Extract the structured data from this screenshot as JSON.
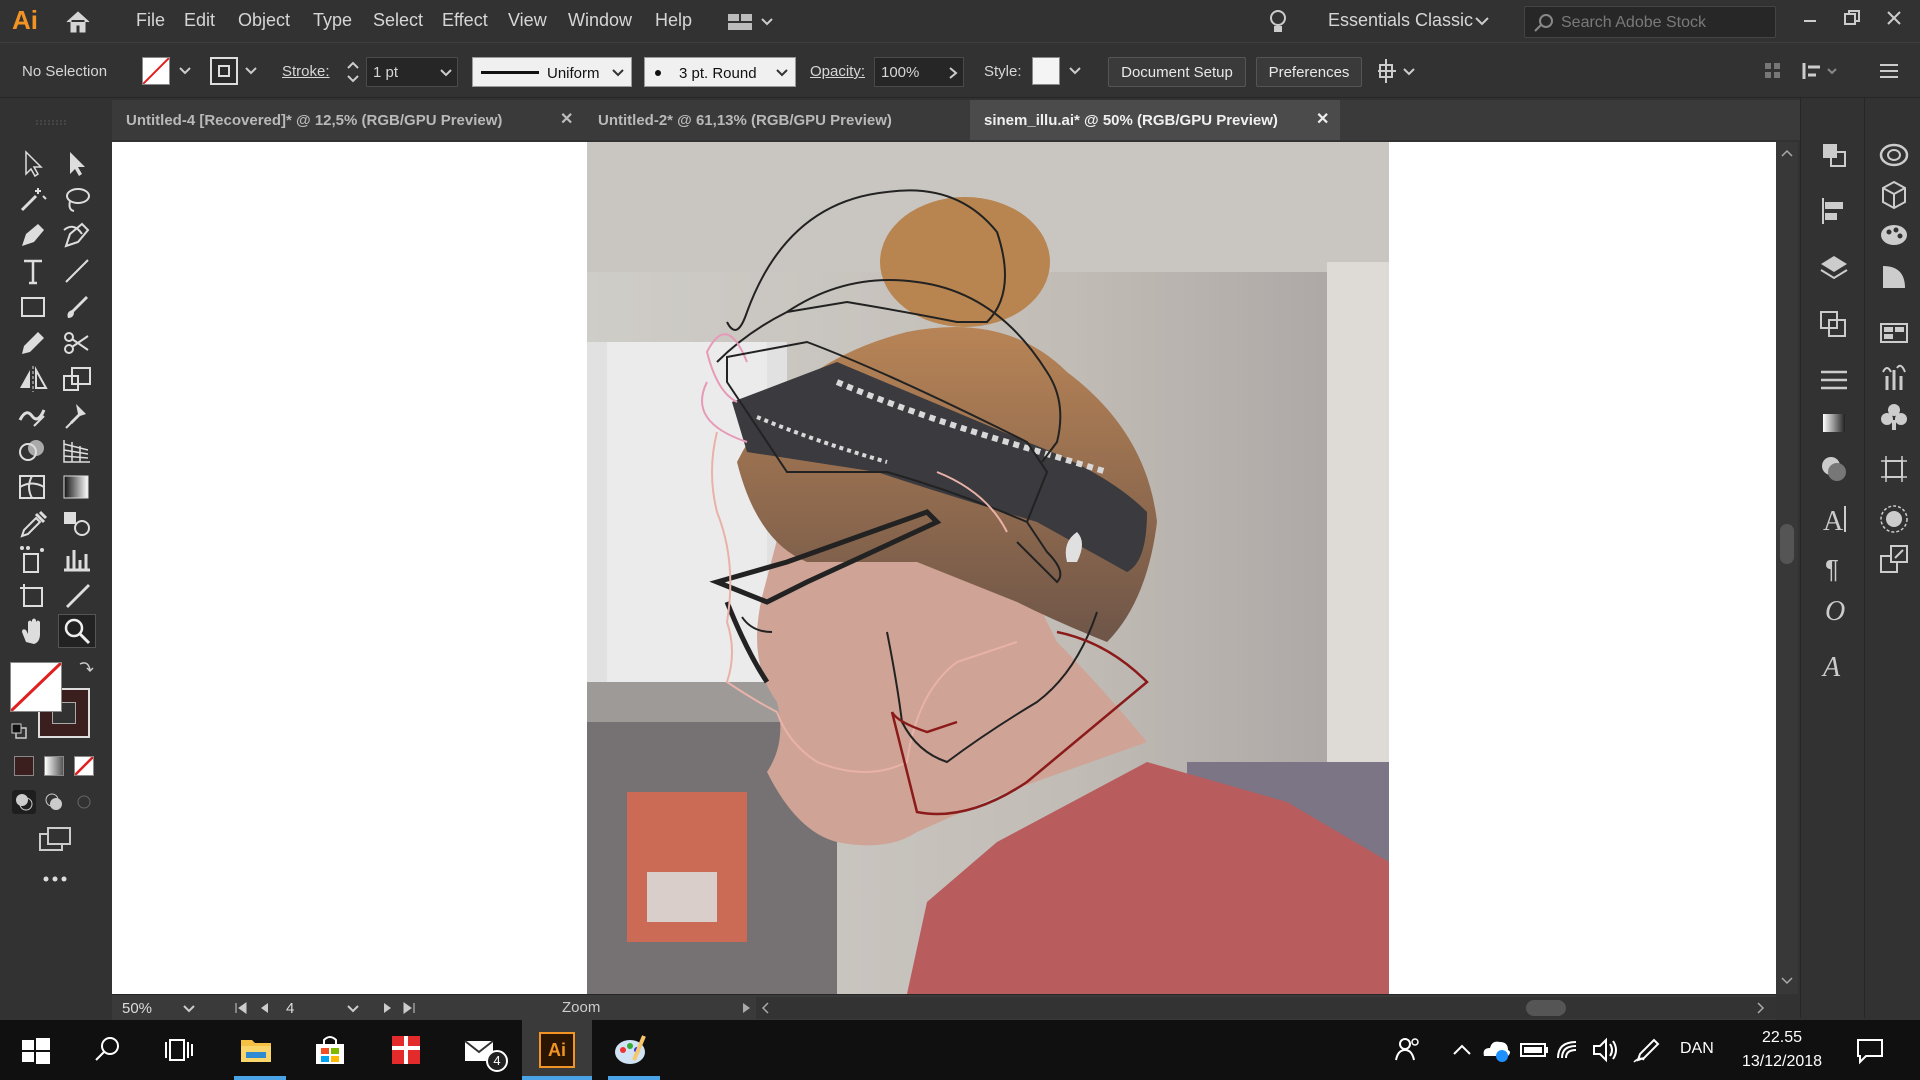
{
  "app": {
    "logo": "Ai",
    "workspace": "Essentials Classic",
    "search_placeholder": "Search Adobe Stock"
  },
  "menu": [
    "File",
    "Edit",
    "Object",
    "Type",
    "Select",
    "Effect",
    "View",
    "Window",
    "Help"
  ],
  "controlbar": {
    "selection": "No Selection",
    "stroke_label": "Stroke:",
    "stroke_value": "1 pt",
    "profile": "Uniform",
    "brush": "3 pt. Round",
    "opacity_label": "Opacity:",
    "opacity_value": "100%",
    "style_label": "Style:",
    "doc_setup": "Document Setup",
    "preferences": "Preferences"
  },
  "tabs": [
    {
      "label": "Untitled-4 [Recovered]* @ 12,5% (RGB/GPU Preview)",
      "active": false
    },
    {
      "label": "Untitled-2* @ 61,13% (RGB/GPU Preview)",
      "active": false
    },
    {
      "label": "sinem_illu.ai* @ 50% (RGB/GPU Preview)",
      "active": true
    }
  ],
  "statusbar": {
    "zoom": "50%",
    "artboard": "4",
    "tool": "Zoom"
  },
  "taskbar": {
    "time": "22.55",
    "date": "13/12/2018",
    "lang": "DAN",
    "mail_badge": "4"
  },
  "colors": {
    "accent": "#f29423",
    "canvas": "#ffffff",
    "ui_bg": "#323232",
    "stroke_outline": "#8b1a1a"
  }
}
